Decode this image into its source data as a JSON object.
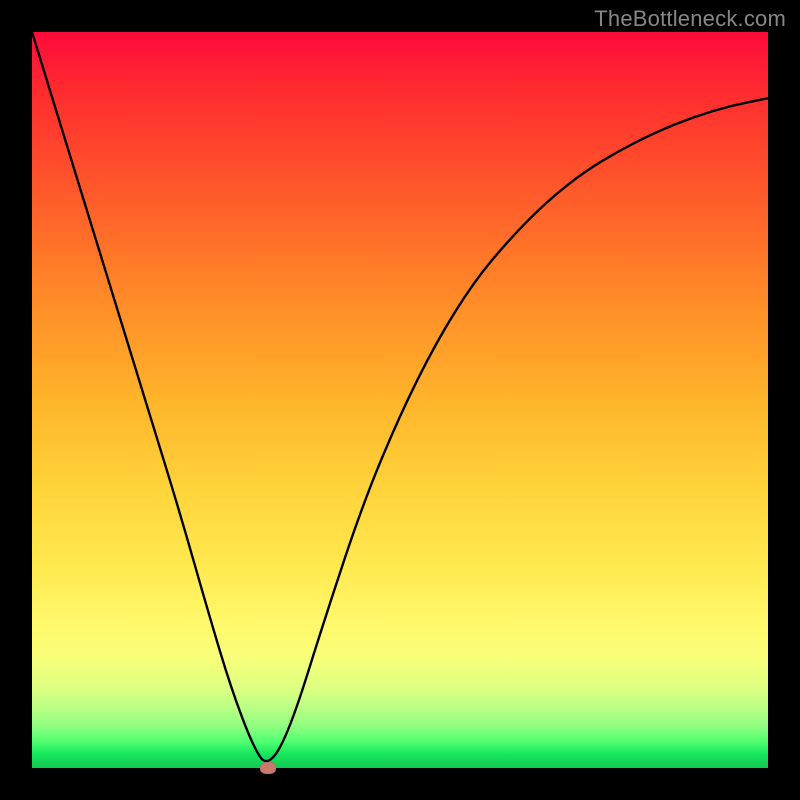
{
  "watermark": "TheBottleneck.com",
  "chart_data": {
    "type": "line",
    "title": "",
    "xlabel": "",
    "ylabel": "",
    "xlim": [
      0,
      1
    ],
    "ylim": [
      0,
      1
    ],
    "grid": false,
    "background_gradient": {
      "direction": "vertical",
      "stops": [
        {
          "pos": 0.0,
          "color": "#ff0b3b"
        },
        {
          "pos": 0.5,
          "color": "#ffb42a"
        },
        {
          "pos": 0.8,
          "color": "#fff86a"
        },
        {
          "pos": 1.0,
          "color": "#12c854"
        }
      ]
    },
    "series": [
      {
        "name": "bottleneck-curve",
        "stroke": "#000000",
        "x": [
          0.0,
          0.04,
          0.08,
          0.12,
          0.16,
          0.2,
          0.24,
          0.27,
          0.3,
          0.32,
          0.35,
          0.4,
          0.45,
          0.5,
          0.55,
          0.6,
          0.65,
          0.7,
          0.75,
          0.8,
          0.85,
          0.9,
          0.95,
          1.0
        ],
        "values": [
          1.0,
          0.87,
          0.74,
          0.61,
          0.48,
          0.35,
          0.21,
          0.11,
          0.03,
          0.0,
          0.05,
          0.21,
          0.36,
          0.48,
          0.58,
          0.66,
          0.72,
          0.77,
          0.81,
          0.84,
          0.865,
          0.885,
          0.9,
          0.91
        ]
      }
    ],
    "marker": {
      "x": 0.32,
      "y": 0.0,
      "color": "#c97a6f"
    }
  }
}
